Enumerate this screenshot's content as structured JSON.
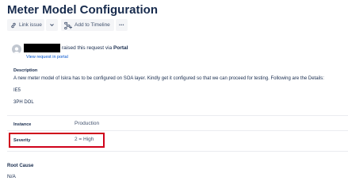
{
  "page": {
    "title": "Meter Model Configuration"
  },
  "toolbar": {
    "link_issue_label": "Link issue",
    "add_to_timeline_label": "Add to Timeline",
    "more_label": "•••"
  },
  "request": {
    "raised_text": "raised this request via",
    "channel": "Portal",
    "view_link": "View request in portal"
  },
  "fields": {
    "description_label": "Description",
    "description_text": "A new meter model of Iskra has to be configured on SOA layer. Kindly get it configured so that we can proceed for testing. Following are the Details:",
    "detail_1": "IE5",
    "detail_2": "3PH DOL",
    "instance_label": "Instance",
    "instance_value": "Production",
    "severity_label": "Severity",
    "severity_value": "2 = High",
    "root_cause_label": "Root Cause",
    "root_cause_value": "N/A"
  },
  "colors": {
    "highlight_border": "#d0021b",
    "link": "#0052cc",
    "button_bg": "#f4f5f7"
  },
  "icons": {
    "link_issue": "link-icon",
    "dropdown": "chevron-down-icon",
    "timeline": "timeline-icon",
    "more": "more-icon",
    "avatar": "user-avatar-icon"
  }
}
